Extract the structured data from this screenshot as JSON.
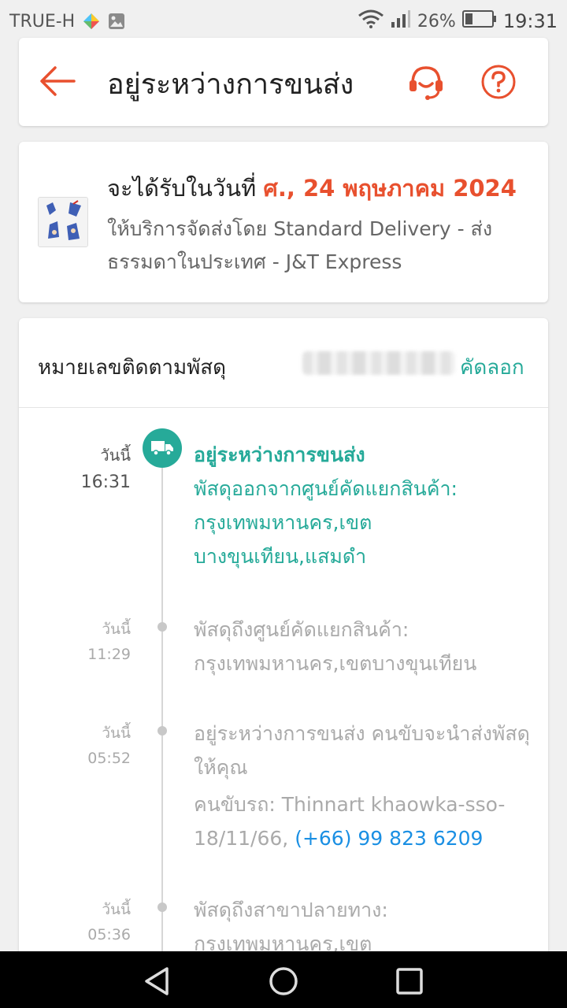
{
  "status_bar": {
    "carrier": "TRUE-H",
    "battery": "26%",
    "time": "19:31",
    "icons": [
      "assistant-icon",
      "gallery-icon",
      "wifi-icon",
      "signal-icon",
      "battery-icon"
    ]
  },
  "header": {
    "title": "อยู่ระหว่างการขนส่ง",
    "icons": [
      "back-arrow-icon",
      "support-headset-icon",
      "help-icon"
    ],
    "accent": "#e8502e"
  },
  "delivery": {
    "eta_lead": "จะได้รับในวันที่",
    "eta_date": "ศ., 24 พฤษภาคม 2024",
    "service": "ให้บริการจัดส่งโดย Standard Delivery - ส่งธรรมดาในประเทศ - J&T Express"
  },
  "tracking": {
    "label": "หมายเลขติดตามพัสดุ",
    "copy": "คัดลอก",
    "events": [
      {
        "day": "วันนี้",
        "time": "16:31",
        "status": "อยู่ระหว่างการขนส่ง",
        "detail": "พัสดุออกจากศูนย์คัดแยกสินค้า: กรุงเทพมหานคร,เขตบางขุนเทียน,แสมดำ"
      },
      {
        "day": "วันนี้",
        "time": "11:29",
        "detail": "พัสดุถึงศูนย์คัดแยกสินค้า: กรุงเทพมหานคร,เขตบางขุนเทียน"
      },
      {
        "day": "วันนี้",
        "time": "05:52",
        "detail": "อยู่ระหว่างการขนส่ง คนขับจะนำส่งพัสดุให้คุณ",
        "driver": "คนขับรถ: Thinnart khaowka-sso-18/11/66,",
        "phone": "(+66) 99 823 6209"
      },
      {
        "day": "วันนี้",
        "time": "05:36",
        "detail": "พัสดุถึงสาขาปลายทาง: กรุงเทพมหานคร,เขต"
      }
    ],
    "colors": {
      "active": "#26aa99",
      "link": "#1a8fe3",
      "muted": "#aaaaaa"
    }
  },
  "nav_bar": {
    "icons": [
      "back-triangle-icon",
      "home-circle-icon",
      "recents-square-icon"
    ]
  }
}
